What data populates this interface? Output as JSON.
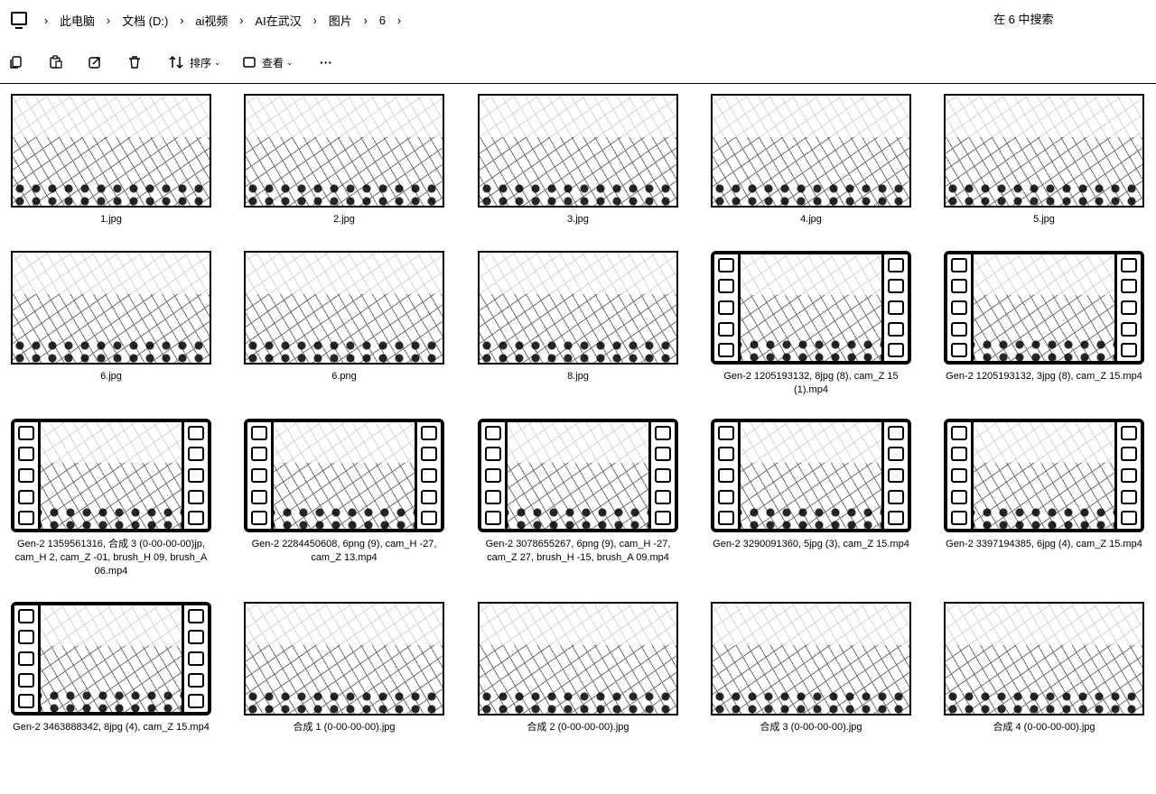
{
  "address_bar": {
    "crumbs": [
      "此电脑",
      "文档 (D:)",
      "ai视频",
      "AI在武汉",
      "图片",
      "6"
    ],
    "search_placeholder": "在 6 中搜索"
  },
  "toolbar": {
    "sort_label": "排序",
    "view_label": "查看",
    "more_label": "···"
  },
  "files": [
    "1.jpg",
    "2.jpg",
    "3.jpg",
    "4.jpg",
    "5.jpg",
    "6.jpg",
    "6.png",
    "8.jpg",
    "Gen-2 1205193132, 8jpg (8), cam_Z 15 (1).mp4",
    "Gen-2 1205193132, 3jpg (8), cam_Z 15.mp4",
    "Gen-2 1359561316, 合成 3 (0-00-00-00)jp, cam_H 2, cam_Z -01, brush_H 09, brush_A 06.mp4",
    "Gen-2 2284450608, 6png (9), cam_H -27, cam_Z 13.mp4",
    "Gen-2 3078655267, 6png (9), cam_H -27, cam_Z 27, brush_H -15, brush_A 09.mp4",
    "Gen-2 3290091360, 5jpg (3), cam_Z 15.mp4",
    "Gen-2 3397194385, 6jpg (4), cam_Z 15.mp4",
    "Gen-2 3463888342, 8jpg (4), cam_Z 15.mp4",
    "合成 1 (0-00-00-00).jpg",
    "合成 2 (0-00-00-00).jpg",
    "合成 3 (0-00-00-00).jpg",
    "合成 4 (0-00-00-00).jpg"
  ]
}
